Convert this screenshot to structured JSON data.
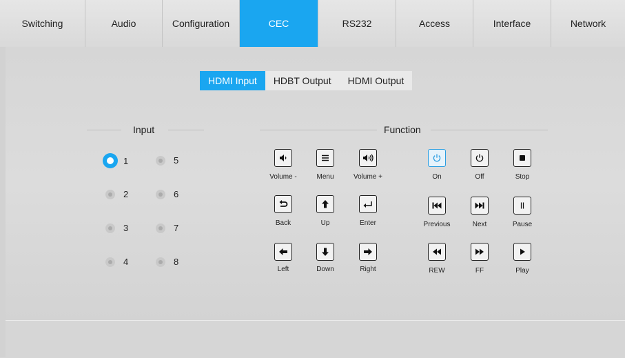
{
  "tabs": [
    {
      "label": "Switching",
      "active": false
    },
    {
      "label": "Audio",
      "active": false
    },
    {
      "label": "Configuration",
      "active": false
    },
    {
      "label": "CEC",
      "active": true
    },
    {
      "label": "RS232",
      "active": false
    },
    {
      "label": "Access",
      "active": false
    },
    {
      "label": "Interface",
      "active": false
    },
    {
      "label": "Network",
      "active": false
    }
  ],
  "subtabs": [
    {
      "label": "HDMI Input",
      "active": true
    },
    {
      "label": "HDBT Output",
      "active": false
    },
    {
      "label": "HDMI Output",
      "active": false
    }
  ],
  "input_section": {
    "title": "Input",
    "selected": "1",
    "options": [
      "1",
      "2",
      "3",
      "4",
      "5",
      "6",
      "7",
      "8"
    ]
  },
  "function_section": {
    "title": "Function",
    "buttons": [
      {
        "label": "Volume -",
        "icon": "volume-down-icon",
        "active": false
      },
      {
        "label": "Menu",
        "icon": "menu-icon",
        "active": false
      },
      {
        "label": "Volume +",
        "icon": "volume-up-icon",
        "active": false
      },
      {
        "label": "On",
        "icon": "power-on-icon",
        "active": true
      },
      {
        "label": "Off",
        "icon": "power-off-icon",
        "active": false
      },
      {
        "label": "Stop",
        "icon": "stop-icon",
        "active": false
      },
      {
        "label": "Back",
        "icon": "back-icon",
        "active": false
      },
      {
        "label": "Up",
        "icon": "arrow-up-icon",
        "active": false
      },
      {
        "label": "Enter",
        "icon": "enter-icon",
        "active": false
      },
      {
        "label": "Previous",
        "icon": "previous-icon",
        "active": false
      },
      {
        "label": "Next",
        "icon": "next-icon",
        "active": false
      },
      {
        "label": "Pause",
        "icon": "pause-icon",
        "active": false
      },
      {
        "label": "Left",
        "icon": "arrow-left-icon",
        "active": false
      },
      {
        "label": "Down",
        "icon": "arrow-down-icon",
        "active": false
      },
      {
        "label": "Right",
        "icon": "arrow-right-icon",
        "active": false
      },
      {
        "label": "REW",
        "icon": "rewind-icon",
        "active": false
      },
      {
        "label": "FF",
        "icon": "fast-forward-icon",
        "active": false
      },
      {
        "label": "Play",
        "icon": "play-icon",
        "active": false
      }
    ]
  },
  "colors": {
    "accent": "#1aa6f0",
    "background": "#d7d7d7"
  }
}
